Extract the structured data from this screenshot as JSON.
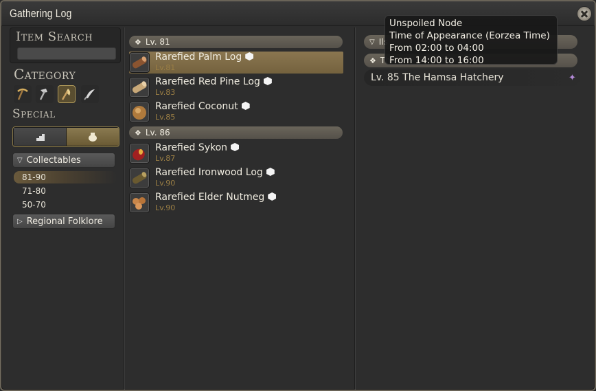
{
  "window": {
    "title": "Gathering Log"
  },
  "search": {
    "label": "Item Search",
    "value": ""
  },
  "category": {
    "label": "Category",
    "icons": [
      "pickaxe-icon",
      "hammer-icon",
      "hatchet-icon",
      "sickle-icon"
    ],
    "active_index": 2
  },
  "special": {
    "label": "Special",
    "options": [
      "stair-icon",
      "bag-icon"
    ],
    "active_index": 1
  },
  "collectables": {
    "label": "Collectables",
    "levels": [
      "81-90",
      "71-80",
      "50-70"
    ],
    "active_level": "81-90"
  },
  "regional": {
    "label": "Regional Folklore"
  },
  "groups": [
    {
      "header": "Lv. 81",
      "items": [
        {
          "name": "Rarefied Palm Log",
          "level": "Lv.81",
          "selected": true,
          "icon": "log-icon"
        },
        {
          "name": "Rarefied Red Pine Log",
          "level": "Lv.83",
          "selected": false,
          "icon": "log-icon"
        },
        {
          "name": "Rarefied Coconut",
          "level": "Lv.85",
          "selected": false,
          "icon": "coconut-icon"
        }
      ]
    },
    {
      "header": "Lv. 86",
      "items": [
        {
          "name": "Rarefied Sykon",
          "level": "Lv.87",
          "selected": false,
          "icon": "fruit-icon"
        },
        {
          "name": "Rarefied Ironwood Log",
          "level": "Lv.90",
          "selected": false,
          "icon": "log-icon"
        },
        {
          "name": "Rarefied Elder Nutmeg",
          "level": "Lv.90",
          "selected": false,
          "icon": "nutmeg-icon"
        }
      ]
    }
  ],
  "right_panel": {
    "header1": "Ils",
    "header2": "Th",
    "node": "Lv. 85  The Hamsa Hatchery"
  },
  "tooltip": {
    "line1": "Unspoiled Node",
    "line2": "Time of Appearance (Eorzea Time)",
    "line3": "From 02:00 to 04:00",
    "line4": "From 14:00 to 16:00"
  }
}
